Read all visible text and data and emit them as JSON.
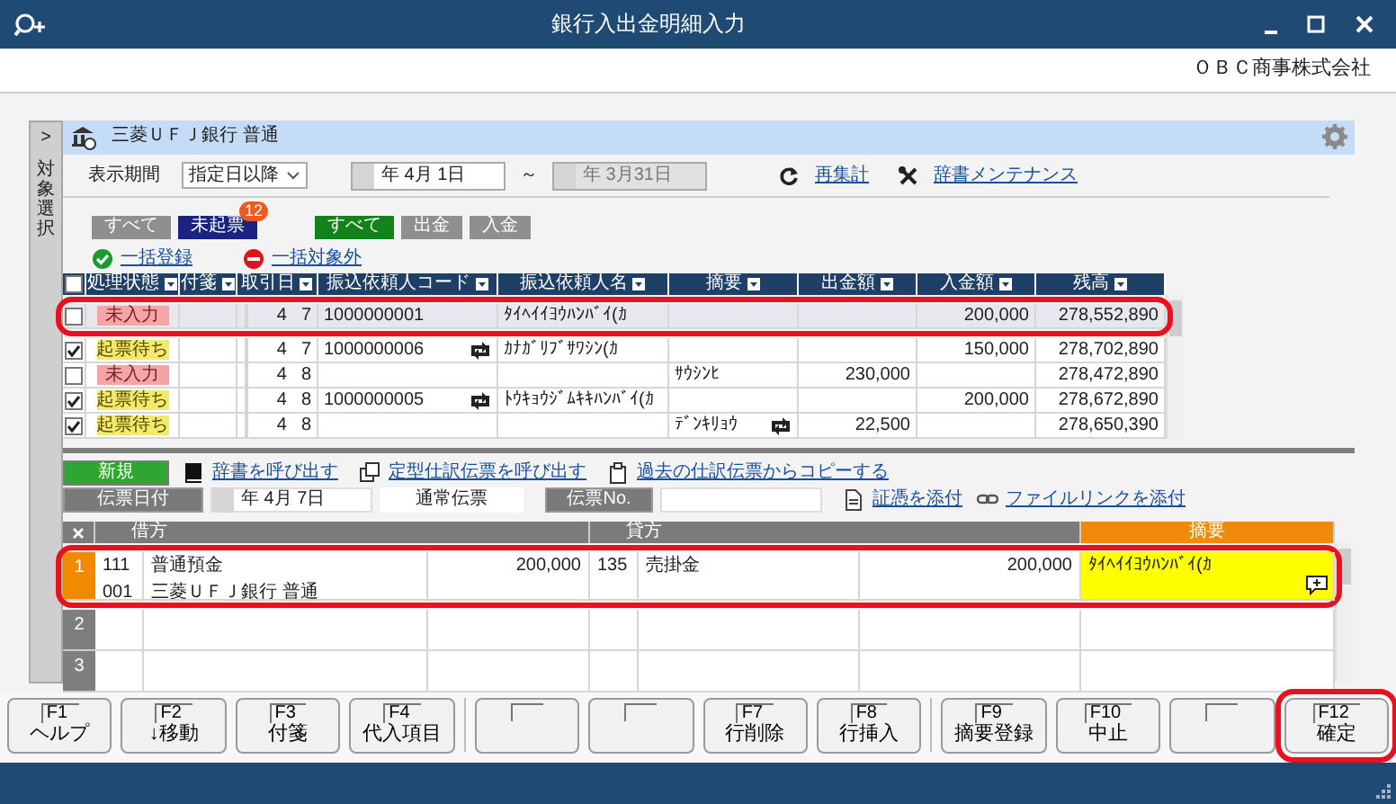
{
  "window": {
    "title": "銀行入出金明細入力",
    "company": "ＯＢＣ商事株式会社"
  },
  "side_tab": {
    "arrow": ">",
    "label": "対象選択"
  },
  "account": {
    "name": "三菱ＵＦＪ銀行 普通"
  },
  "period": {
    "label": "表示期間",
    "mode": "指定日以降",
    "from": "年  4月  1日",
    "separator": "～",
    "to": "年  3月31日",
    "to_disabled": true
  },
  "actions": [
    {
      "label": "再集計",
      "kind": "refresh"
    },
    {
      "label": "辞書メンテナンス",
      "kind": "tools"
    }
  ],
  "status_filters": [
    {
      "label": "すべて",
      "selected": false
    },
    {
      "label": "未起票",
      "selected": true,
      "badge": "12"
    }
  ],
  "type_filters": [
    {
      "label": "すべて",
      "selected": true
    },
    {
      "label": "出金",
      "selected": false
    },
    {
      "label": "入金",
      "selected": false
    }
  ],
  "bulk_links": [
    {
      "label": "一括登録",
      "kind": "register"
    },
    {
      "label": "一括対象外",
      "kind": "exclude"
    }
  ],
  "table": {
    "select_all_checked": false,
    "columns": [
      "処理状態",
      "付箋",
      "取引日",
      "振込依頼人コード",
      "振込依頼人名",
      "摘要",
      "出金額",
      "入金額",
      "残高"
    ],
    "rows": [
      {
        "checked": false,
        "status": "未入力",
        "kind": "unentered",
        "month": "4",
        "day": "7",
        "code": "1000000001",
        "name": "ﾀｲﾍｲｲﾖｳﾊﾝﾊﾞｲ(ｶ",
        "deposit": "200,000",
        "balance": "278,552,890",
        "selected": true,
        "highlighted": true
      },
      {
        "checked": true,
        "status": "起票待ち",
        "kind": "waiting",
        "month": "4",
        "day": "7",
        "code": "1000000006",
        "code_linked": true,
        "name": "ｶﾅｶﾞﾘﾌﾞｻﾜｼﾝ(ｶ",
        "deposit": "150,000",
        "balance": "278,702,890",
        "selected": false,
        "highlighted": false
      },
      {
        "checked": false,
        "status": "未入力",
        "kind": "unentered",
        "month": "4",
        "day": "8",
        "memo": "ｻｳｼﾝﾋ",
        "withdrawal": "230,000",
        "balance": "278,472,890",
        "selected": false,
        "highlighted": false
      },
      {
        "checked": true,
        "status": "起票待ち",
        "kind": "waiting",
        "month": "4",
        "day": "8",
        "code": "1000000005",
        "code_linked": true,
        "name": "ﾄｳｷｮｳｼﾞﾑｷｷﾊﾝﾊﾞｲ(ｶ",
        "deposit": "200,000",
        "balance": "278,672,890",
        "selected": false,
        "highlighted": false
      },
      {
        "checked": true,
        "status": "起票待ち",
        "kind": "waiting",
        "month": "4",
        "day": "8",
        "memo": "ﾃﾞﾝｷﾘｮｳ",
        "memo_linked": true,
        "withdrawal": "22,500",
        "balance": "278,650,390",
        "selected": false,
        "highlighted": false
      }
    ]
  },
  "entry": {
    "new_button": "新規",
    "links": [
      {
        "label": "辞書を呼び出す",
        "kind": "book"
      },
      {
        "label": "定型仕訳伝票を呼び出す",
        "kind": "copy"
      },
      {
        "label": "過去の仕訳伝票からコピーする",
        "kind": "clip"
      }
    ],
    "date_label": "伝票日付",
    "date": "年  4月  7日",
    "voucher_type": "通常伝票",
    "number_label": "伝票No.",
    "attach_links": [
      {
        "label": "証憑を添付",
        "kind": "doc"
      },
      {
        "label": "ファイルリンクを添付",
        "kind": "chain"
      }
    ]
  },
  "journal": {
    "columns": [
      "借方",
      "貸方",
      "摘要"
    ],
    "rows": [
      {
        "number": "1",
        "selected": true,
        "highlighted": true,
        "debit_code": "111",
        "debit_name": "普通預金",
        "debit_sub_code": "001",
        "debit_sub_name": "三菱ＵＦＪ銀行 普通",
        "debit_amount": "200,000",
        "credit_code": "135",
        "credit_name": "売掛金",
        "credit_amount": "200,000",
        "memo": "ﾀｲﾍｲｲﾖｳﾊﾝﾊﾞｲ(ｶ",
        "memo_focused": true,
        "memo_note": true
      },
      {
        "number": "2",
        "selected": false,
        "highlighted": false
      },
      {
        "number": "3",
        "selected": false,
        "highlighted": false
      }
    ]
  },
  "function_keys": [
    [
      {
        "kind": "key",
        "key": "F1",
        "label": "ヘルプ"
      },
      {
        "kind": "key",
        "key": "F2",
        "label": "↓移動"
      },
      {
        "kind": "key",
        "key": "F3",
        "label": "付箋"
      },
      {
        "kind": "key",
        "key": "F4",
        "label": "代入項目"
      }
    ],
    [
      {
        "kind": "empty"
      },
      {
        "kind": "empty"
      },
      {
        "kind": "key",
        "key": "F7",
        "label": "行削除"
      },
      {
        "kind": "key",
        "key": "F8",
        "label": "行挿入"
      }
    ],
    [
      {
        "kind": "key",
        "key": "F9",
        "label": "摘要登録"
      },
      {
        "kind": "key",
        "key": "F10",
        "label": "中止"
      },
      {
        "kind": "empty"
      },
      {
        "kind": "key",
        "key": "F12",
        "label": "確定",
        "highlighted": true
      }
    ]
  ]
}
